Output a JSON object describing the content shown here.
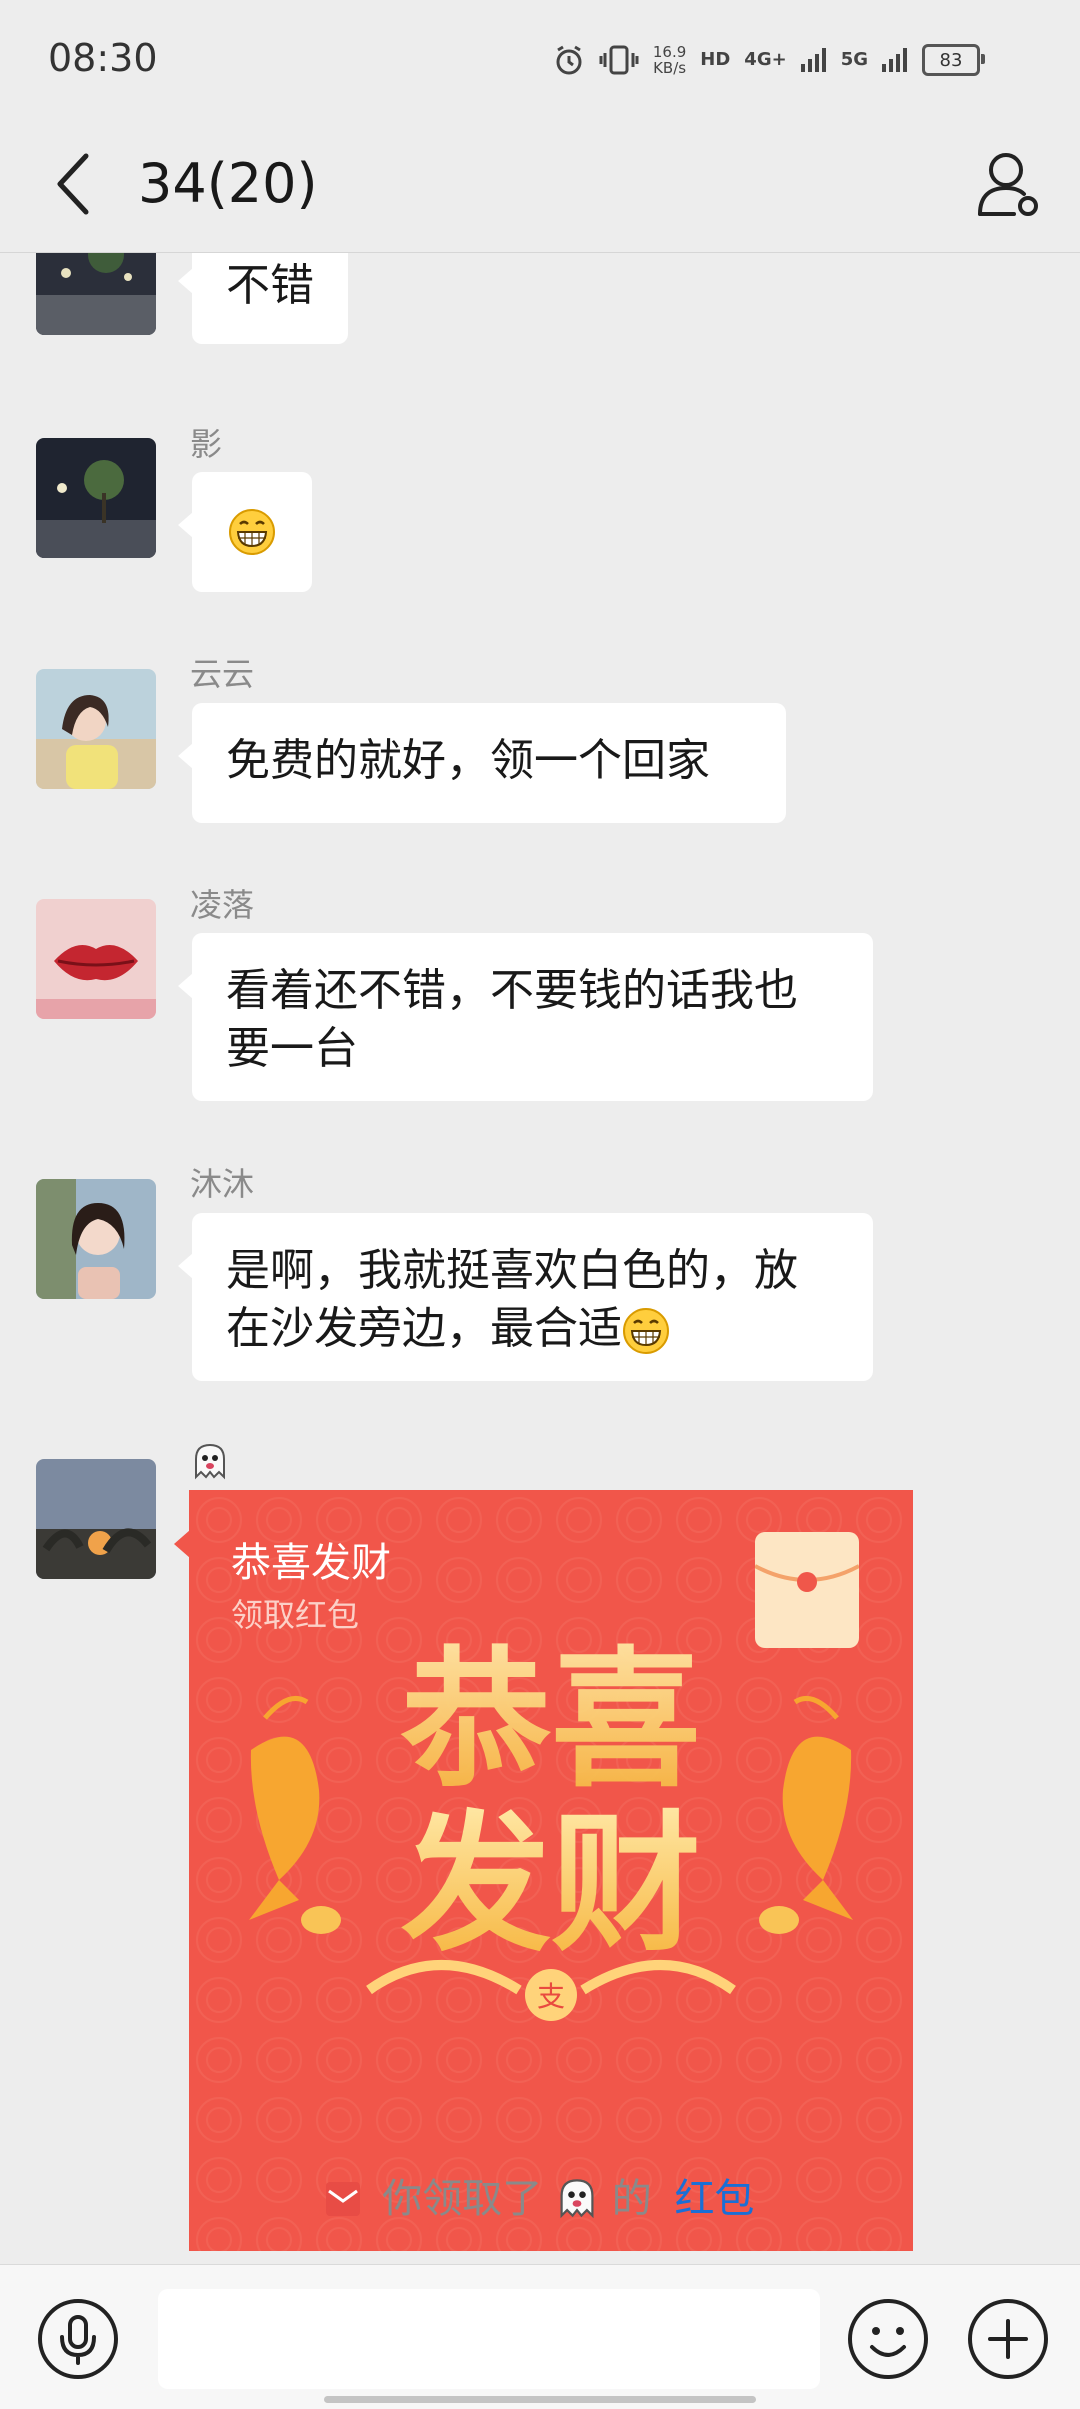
{
  "status_bar": {
    "time": "08:30",
    "speed_value": "16.9",
    "speed_unit": "KB/s",
    "hd_label": "HD",
    "net_4g": "4G+",
    "net_5g": "5G",
    "battery": "83"
  },
  "header": {
    "title": "34(20)"
  },
  "messages": [
    {
      "sender": "",
      "text": "不错"
    },
    {
      "sender": "影",
      "text": ""
    },
    {
      "sender": "云云",
      "text": "免费的就好，领一个回家"
    },
    {
      "sender": "凌落",
      "text": "看着还不错，不要钱的话我也要一台"
    },
    {
      "sender": "沐沐",
      "text": "是啊，我就挺喜欢白色的，放在沙发旁边，最合适"
    }
  ],
  "red_packet": {
    "title": "恭喜发财",
    "subtitle": "领取红包",
    "art_line1": "恭喜",
    "art_line2": "发财",
    "footer_label": "红包"
  },
  "system_note": {
    "prefix": "你领取了",
    "middle": "的",
    "link": "红包"
  },
  "colors": {
    "background": "#ededed",
    "bubble": "#ffffff",
    "red_packet": "#f1564a",
    "link": "#1a6fd6"
  }
}
